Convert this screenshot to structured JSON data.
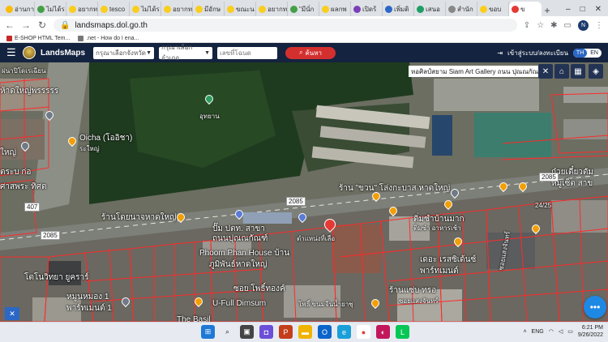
{
  "browser": {
    "tabs": [
      {
        "label": "อ่านกา",
        "color": "#fbbc04"
      },
      {
        "label": "ไม่ได้ร",
        "color": "#43a047"
      },
      {
        "label": "อยากท",
        "color": "#f9ce1d"
      },
      {
        "label": "tesco",
        "color": "#f9ce1d"
      },
      {
        "label": "ไม่ได้ร",
        "color": "#f9ce1d"
      },
      {
        "label": "อยากท",
        "color": "#f9ce1d"
      },
      {
        "label": "มีอักษ",
        "color": "#f9ce1d"
      },
      {
        "label": "ขณะน",
        "color": "#f9ce1d"
      },
      {
        "label": "อยากท",
        "color": "#f9ce1d"
      },
      {
        "label": "\"มีนั่ก",
        "color": "#43a047"
      },
      {
        "label": "ผลกพ",
        "color": "#f9ce1d"
      },
      {
        "label": "เปิดร้",
        "color": "#7b3fb8"
      },
      {
        "label": "เพิ่มติ",
        "color": "#2b67c6"
      },
      {
        "label": "เสนอ",
        "color": "#1e9e63"
      },
      {
        "label": "สำนัก",
        "color": "#888888"
      },
      {
        "label": "ขอบ",
        "color": "#f9ce1d"
      },
      {
        "label": "ข",
        "color": "#e53935"
      }
    ],
    "new_tab": "+",
    "window_controls": [
      "–",
      "□",
      "✕"
    ],
    "url": "landsmaps.dol.go.th",
    "profile_initial": "N",
    "bookmarks": [
      {
        "label": "E-SHOP HTML Tem..."
      },
      {
        "label": ".net - How do I ena..."
      }
    ]
  },
  "app": {
    "brand": "LandsMaps",
    "province_placeholder": "กรุณาเลือกจังหวัด",
    "district_placeholder": "กรุณาเลือกอำเภอ",
    "parcel_placeholder": "เลขที่โฉนด",
    "search_label": "ค้นหา",
    "login_label": "เข้าสู่ระบบ/ลงทะเบียน",
    "lang_th": "TH",
    "lang_en": "EN"
  },
  "map": {
    "tooltip": "หอศิลป์สยาม Siam Art Gallery ถนน ปุณณกัณฑ์",
    "labels": [
      {
        "text": "ฝนาปิโดเรเฉียน"
      },
      {
        "text": "ห้าดใหญ่พรรรรร"
      },
      {
        "text": "Oicha (โออิชา)"
      },
      {
        "text": "ระใหญ่"
      },
      {
        "text": "ใหญ่"
      },
      {
        "text": "ตระบ ก่อ"
      },
      {
        "text": "ศาสพระ ทิศด"
      },
      {
        "text": "อุทยาน"
      },
      {
        "text": "ร้าน \"ขวน\" โล่งกะบาส หาดใหญ่"
      },
      {
        "text": "ก๋วยเตี๋ยวตัม"
      },
      {
        "text": "หมูเซ็ต สาข"
      },
      {
        "text": "ร้านโดยนาจหาดใหญ่"
      },
      {
        "text": "ปั๊ม ปตท. สาขา"
      },
      {
        "text": "ถนนปุณณกัณฑ์"
      },
      {
        "text": "ตำแหน่งที่เลือ"
      },
      {
        "text": "ติ่มซำบ้านมาก"
      },
      {
        "text": "ติ่มซำ อาหารเช้า"
      },
      {
        "text": "Phoom Phan House บ้าน"
      },
      {
        "text": "ภูมิพันธ์หาดใหญ่"
      },
      {
        "text": "เดอะ เรสซิเด้นซ์"
      },
      {
        "text": "พาร์ทเมนต์"
      },
      {
        "text": "ร้านแซ่บ ทรอ"
      },
      {
        "text": "ซอยแสงจันทร์"
      },
      {
        "text": "โตโนวิทยา ยูคราร์"
      },
      {
        "text": "หมูนหมอง 1"
      },
      {
        "text": "พาร์ทเมนต์ 1"
      },
      {
        "text": "ซอย โพธิ์ทองค์"
      },
      {
        "text": "U-Full Dimsum"
      },
      {
        "text": "โพธิ์ ขนมจีนน้ำยาชุ"
      },
      {
        "text": "24/25"
      },
      {
        "text": "ซอยแสงจันทร์"
      },
      {
        "text": "The Basil"
      }
    ],
    "roads": [
      "2085",
      "2085",
      "2085",
      "407"
    ]
  },
  "taskbar": {
    "time": "6:21 PM",
    "date": "9/26/2022",
    "lang": "ENG"
  }
}
